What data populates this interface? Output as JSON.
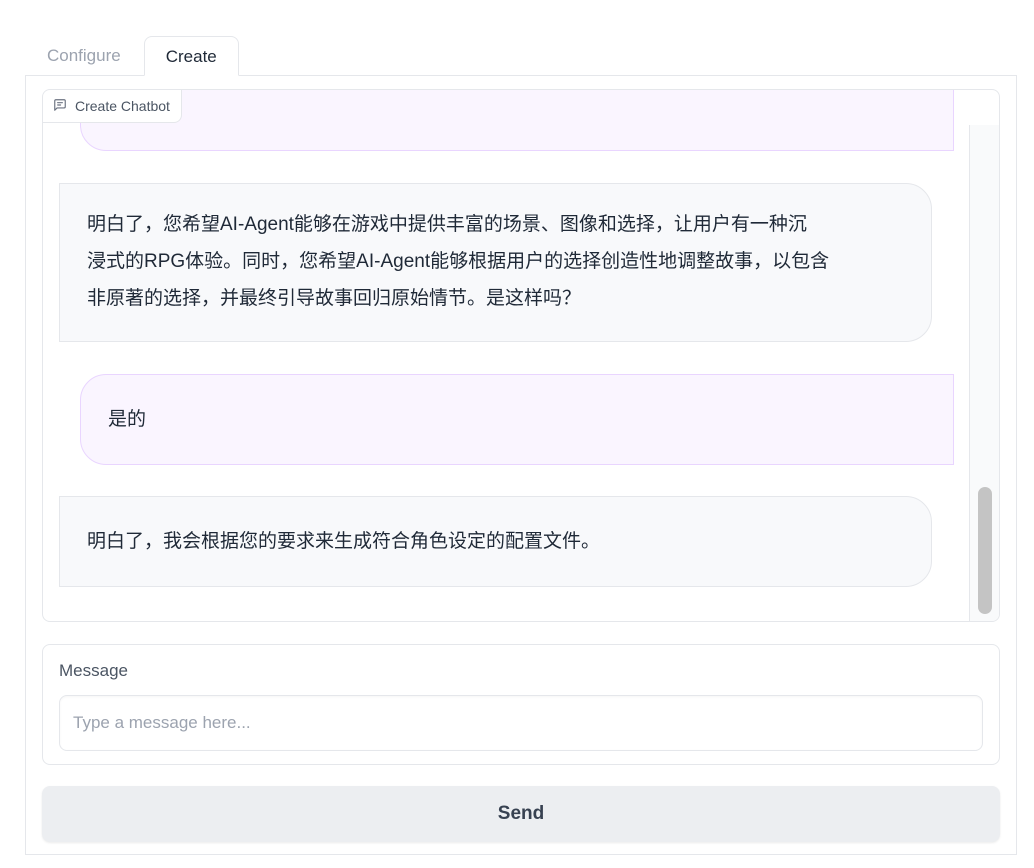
{
  "tabs": [
    {
      "label": "Configure",
      "active": false
    },
    {
      "label": "Create",
      "active": true
    }
  ],
  "chatbot": {
    "label": "Create Chatbot",
    "icon": "chat-icon",
    "messages": [
      {
        "role": "user",
        "lines": [
          ""
        ]
      },
      {
        "role": "bot",
        "lines": [
          "明白了，您希望AI-Agent能够在游戏中提供丰富的场景、图像和选择，让用户有一种沉",
          "浸式的RPG体验。同时，您希望AI-Agent能够根据用户的选择创造性地调整故事，以包含",
          "非原著的选择，并最终引导故事回归原始情节。是这样吗？"
        ]
      },
      {
        "role": "user",
        "lines": [
          "是的"
        ]
      },
      {
        "role": "bot",
        "lines": [
          "明白了，我会根据您的要求来生成符合角色设定的配置文件。"
        ]
      }
    ]
  },
  "message": {
    "label": "Message",
    "placeholder": "Type a message here...",
    "value": ""
  },
  "send_button": {
    "label": "Send"
  },
  "colors": {
    "user_bubble_bg": "#faf5ff",
    "user_bubble_border": "#e9d5ff",
    "bot_bubble_bg": "#f8f9fb",
    "border": "#e5e7eb"
  }
}
